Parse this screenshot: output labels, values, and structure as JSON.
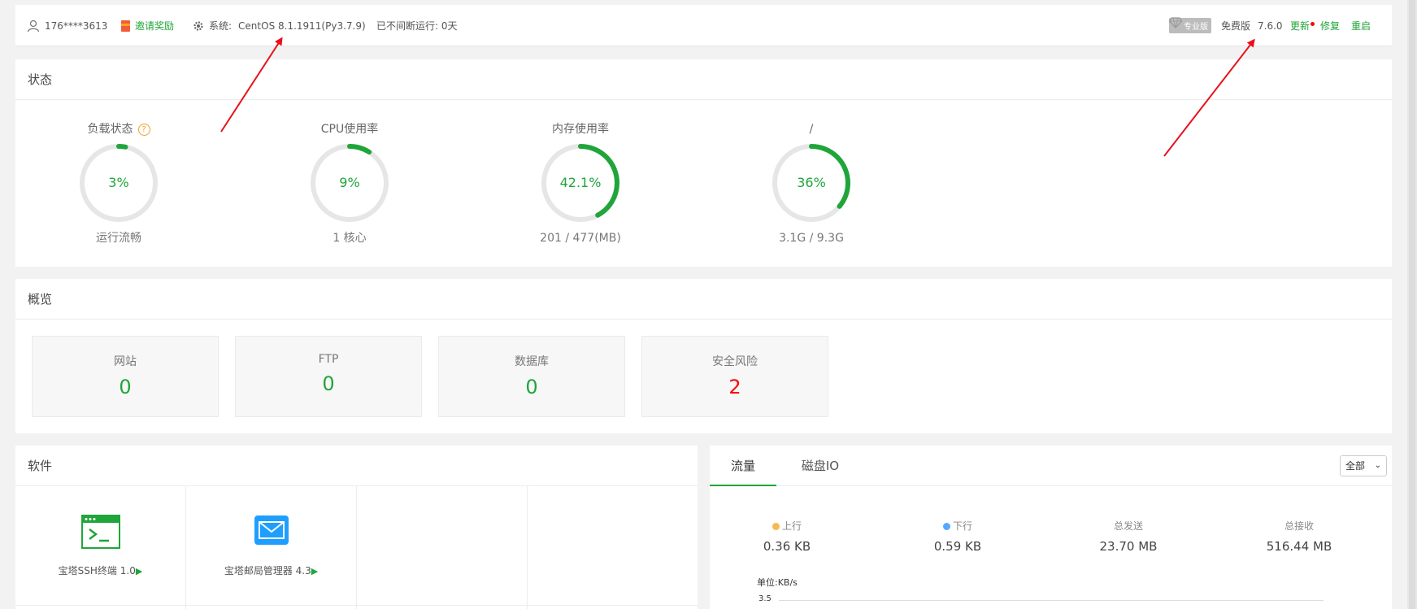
{
  "header": {
    "user": "176****3613",
    "invite": "邀请奖励",
    "system_label": "系统:",
    "system_value": "CentOS 8.1.1911(Py3.7.9)",
    "uptime": "已不间断运行: 0天",
    "pro_badge": "专业版",
    "edition": "免费版",
    "version": "7.6.0",
    "update": "更新",
    "repair": "修复",
    "restart": "重启"
  },
  "status": {
    "title": "状态",
    "gauges": [
      {
        "label": "负载状态",
        "value": "3%",
        "sub": "运行流畅",
        "percent": 3
      },
      {
        "label": "CPU使用率",
        "value": "9%",
        "sub": "1 核心",
        "percent": 9
      },
      {
        "label": "内存使用率",
        "value": "42.1%",
        "sub": "201 / 477(MB)",
        "percent": 42.1
      },
      {
        "label": "/",
        "value": "36%",
        "sub": "3.1G / 9.3G",
        "percent": 36
      }
    ],
    "help": "?"
  },
  "overview": {
    "title": "概览",
    "cards": [
      {
        "label": "网站",
        "value": "0"
      },
      {
        "label": "FTP",
        "value": "0"
      },
      {
        "label": "数据库",
        "value": "0"
      },
      {
        "label": "安全风险",
        "value": "2"
      }
    ]
  },
  "software": {
    "title": "软件",
    "items": [
      {
        "name": "宝塔SSH终端 1.0",
        "icon": "terminal-icon"
      },
      {
        "name": "宝塔邮局管理器 4.3",
        "icon": "mail-icon"
      }
    ],
    "play": "▶"
  },
  "traffic": {
    "tabs": [
      "流量",
      "磁盘IO"
    ],
    "select": "全部",
    "stats": [
      {
        "label": "上行",
        "value": "0.36 KB",
        "dot_color": "#f7b851"
      },
      {
        "label": "下行",
        "value": "0.59 KB",
        "dot_color": "#52a9ff"
      },
      {
        "label": "总发送",
        "value": "23.70 MB",
        "dot_color": ""
      },
      {
        "label": "总接收",
        "value": "516.44 MB",
        "dot_color": ""
      }
    ],
    "unit": "单位:KB/s",
    "ytick": "3.5"
  },
  "colors": {
    "accent": "#20a53a",
    "danger": "#ff0000",
    "arrow": "#e8111b"
  }
}
